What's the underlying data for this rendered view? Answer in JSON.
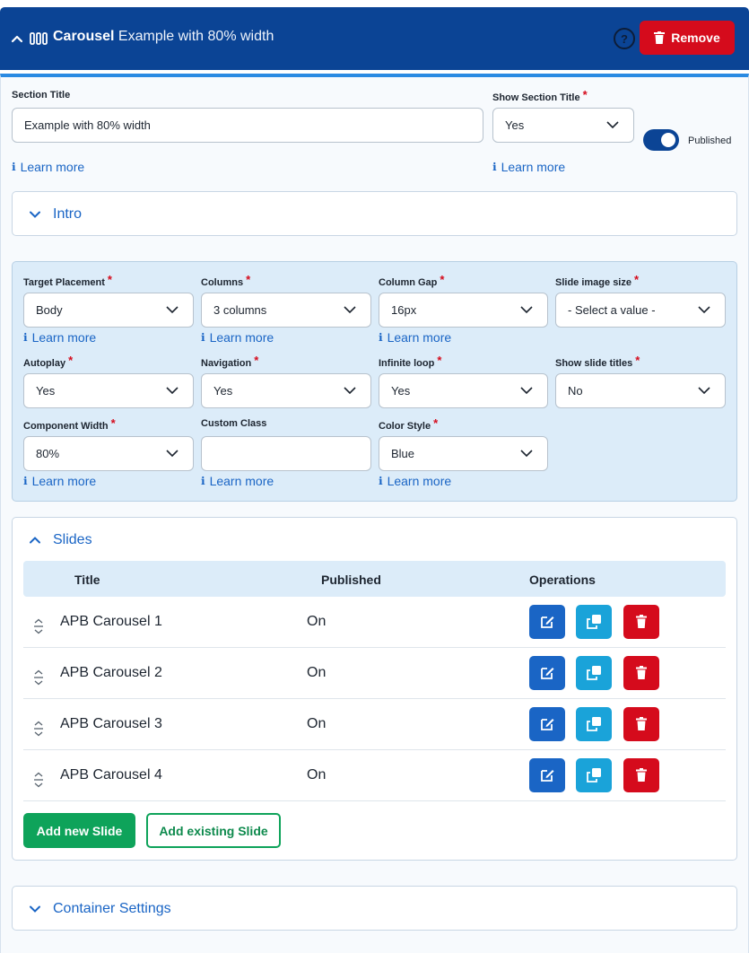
{
  "header": {
    "component_name": "Carousel",
    "section_title": "Example with 80% width",
    "help_label": "?",
    "remove_label": "Remove"
  },
  "section": {
    "section_title_label": "Section Title",
    "section_title_value": "Example with 80% width",
    "show_title_label": "Show Section Title",
    "show_title_value": "Yes",
    "published_label": "Published",
    "published": true,
    "learn_more": "Learn more"
  },
  "intro": {
    "label": "Intro"
  },
  "settings": {
    "target_placement": {
      "label": "Target Placement",
      "value": "Body"
    },
    "columns": {
      "label": "Columns",
      "value": "3 columns"
    },
    "column_gap": {
      "label": "Column Gap",
      "value": "16px"
    },
    "slide_image_size": {
      "label": "Slide image size",
      "value": "- Select a value -"
    },
    "autoplay": {
      "label": "Autoplay",
      "value": "Yes"
    },
    "navigation": {
      "label": "Navigation",
      "value": "Yes"
    },
    "infinite_loop": {
      "label": "Infinite loop",
      "value": "Yes"
    },
    "show_slide_titles": {
      "label": "Show slide titles",
      "value": "No"
    },
    "component_width": {
      "label": "Component Width",
      "value": "80%"
    },
    "custom_class": {
      "label": "Custom Class",
      "value": ""
    },
    "color_style": {
      "label": "Color Style",
      "value": "Blue"
    },
    "learn_more": "Learn more"
  },
  "slides": {
    "label": "Slides",
    "columns": [
      "Title",
      "Published",
      "Operations"
    ],
    "rows": [
      {
        "title": "APB Carousel 1",
        "published": "On"
      },
      {
        "title": "APB Carousel 2",
        "published": "On"
      },
      {
        "title": "APB Carousel 3",
        "published": "On"
      },
      {
        "title": "APB Carousel 4",
        "published": "On"
      }
    ],
    "add_new_label": "Add new Slide",
    "add_existing_label": "Add existing Slide"
  },
  "container_settings": {
    "label": "Container Settings"
  },
  "colors": {
    "header_bg": "#0b4495",
    "accent_blue": "#1a65c5",
    "danger": "#d50b1c",
    "success": "#0ea35a",
    "info": "#1aa3d9",
    "settings_bg": "#dcecf9"
  }
}
